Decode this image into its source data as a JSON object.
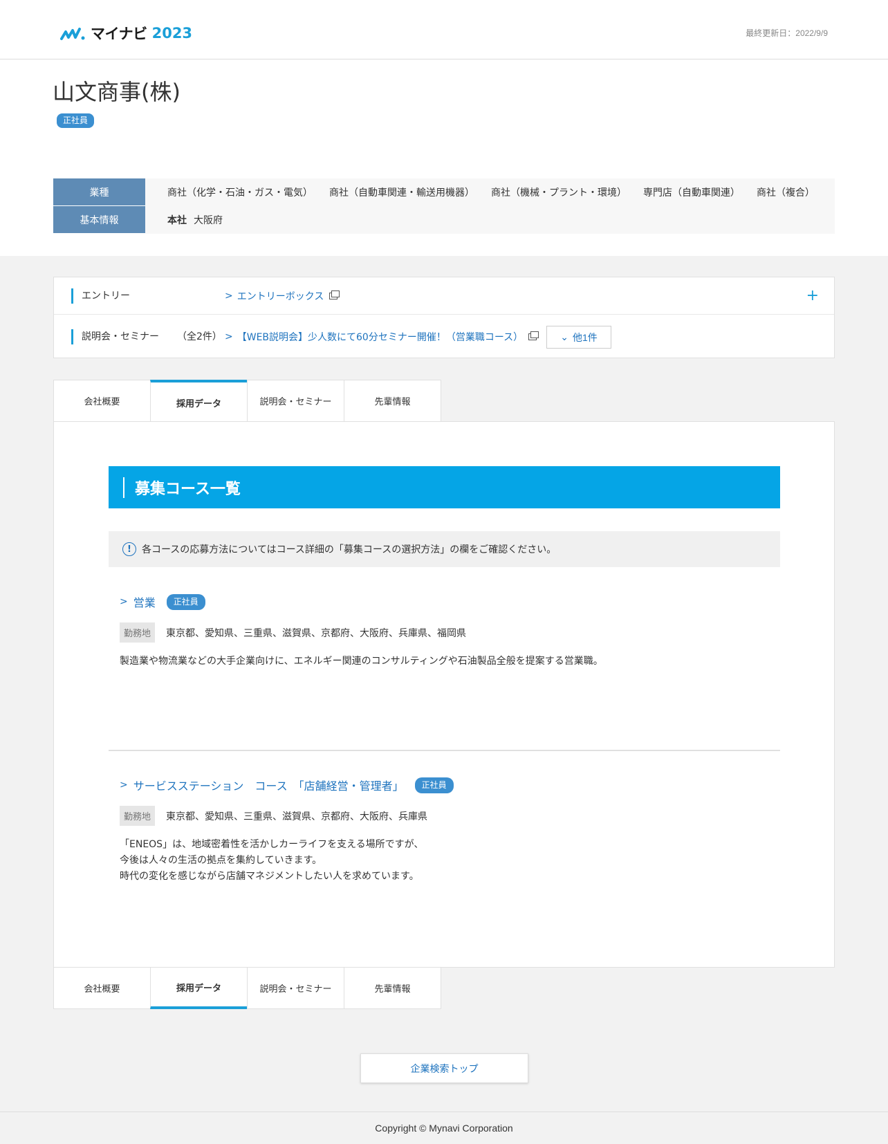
{
  "header": {
    "logo_text": "マイナビ",
    "logo_year": "2023",
    "updated": "最終更新日：2022/9/9"
  },
  "company": {
    "name": "山文商事(株)",
    "badge": "正社員",
    "industry_label": "業種",
    "industries": [
      "商社（化学・石油・ガス・電気）",
      "商社（自動車関連・輸送用機器）",
      "商社（機械・プラント・環境）",
      "専門店（自動車関連）",
      "商社（複合）"
    ],
    "basic_label": "基本情報",
    "hq_label": "本社",
    "hq_value": "大阪府"
  },
  "entry": {
    "entry_label": "エントリー",
    "entry_link": "エントリーボックス",
    "seminar_label": "説明会・セミナー",
    "seminar_count": "（全2件）",
    "seminar_link": "【WEB説明会】少人数にて60分セミナー開催！（営業職コース）",
    "more_label": "他1件",
    "expand_icon": "+"
  },
  "tabs": [
    "会社概要",
    "採用データ",
    "説明会・セミナー",
    "先輩情報"
  ],
  "main": {
    "section_title": "募集コース一覧",
    "notice": "各コースの応募方法についてはコース詳細の「募集コースの選択方法」の欄をご確認ください。",
    "notice_icon": "!",
    "courses": [
      {
        "title": "営業",
        "badge": "正社員",
        "loc_label": "勤務地",
        "locations": "東京都、愛知県、三重県、滋賀県、京都府、大阪府、兵庫県、福岡県",
        "desc": [
          "製造業や物流業などの大手企業向けに、エネルギー関連のコンサルティングや石油製品全般を提案する営業職。"
        ]
      },
      {
        "title": "サービスステーション　コース　「店舗経営・管理者」",
        "badge": "正社員",
        "loc_label": "勤務地",
        "locations": "東京都、愛知県、三重県、滋賀県、京都府、大阪府、兵庫県",
        "desc": [
          "「ENEOS」は、地域密着性を活かしカーライフを支える場所ですが、",
          "今後は人々の生活の拠点を集約していきます。",
          "時代の変化を感じながら店舗マネジメントしたい人を求めています。"
        ]
      }
    ]
  },
  "search_top": "企業検索トップ",
  "footer": "Copyright © Mynavi Corporation",
  "colors": {
    "accent": "#05a5e6",
    "label_bg": "#5e8bb5",
    "link": "#1e73be",
    "badge": "#3b8fd0"
  }
}
